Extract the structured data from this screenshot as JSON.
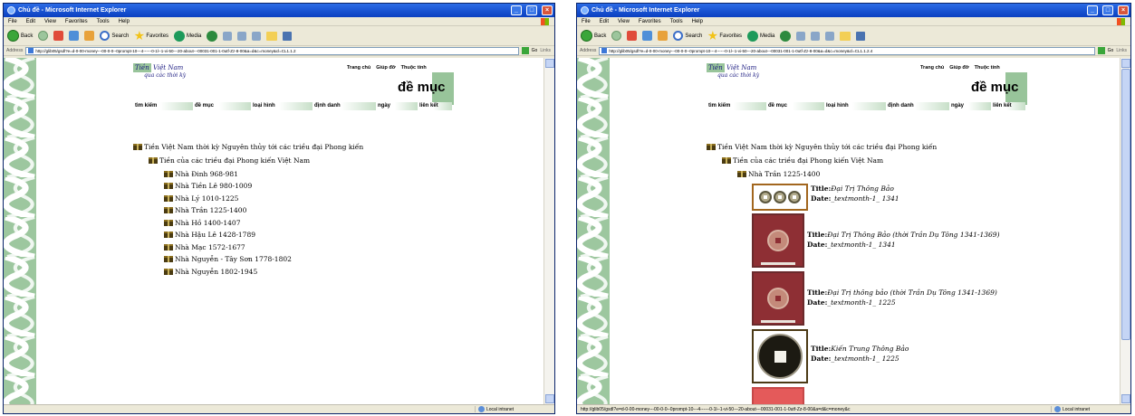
{
  "left": {
    "window_title": "Chủ đề - Microsoft Internet Explorer",
    "menu": [
      "File",
      "Edit",
      "View",
      "Favorites",
      "Tools",
      "Help"
    ],
    "toolbar": {
      "back": "Back",
      "search": "Search",
      "favorites": "Favorites",
      "media": "Media"
    },
    "address": {
      "label": "Address",
      "url": "http://glib05/gsdl?e=d-0-00-money---00-0-0--0prompt-10---4------0-1l--1-vi-50---20-about---00031-001-1-0utf-Zz-8-00&a=d&c=money&cl=CL1.1.2",
      "go": "Go",
      "links": "Links"
    },
    "status": {
      "text": "",
      "zone": "Local intranet"
    },
    "page": {
      "logo": {
        "line1a": "Tiền",
        "line1b": "Việt Nam",
        "line2": "qua các thời kỳ"
      },
      "toplinks": [
        "Trang chủ",
        "Giúp đỡ",
        "Thuộc tính"
      ],
      "section_title": "đề mục",
      "nav": [
        "tìm kiếm",
        "đề mục",
        "loại hình",
        "định danh",
        "ngày",
        "liên kết"
      ],
      "tree": {
        "level1": "Tiền Việt Nam thời kỳ Nguyên thủy tới các triều đại Phong kiến",
        "level2": "Tiền của các triều đại Phong kiến Việt Nam",
        "items": [
          "Nhà Đinh 968-981",
          "Nhà Tiền Lê 980-1009",
          "Nhà Lý 1010-1225",
          "Nhà Trần 1225-1400",
          "Nhà Hồ 1400-1407",
          "Nhà Hậu Lê 1428-1789",
          "Nhà Mạc 1572-1677",
          "Nhà Nguyễn - Tây Sơn 1778-1802",
          "Nhà Nguyễn 1802-1945"
        ]
      }
    }
  },
  "right": {
    "window_title": "Chủ đề - Microsoft Internet Explorer",
    "menu": [
      "File",
      "Edit",
      "View",
      "Favorites",
      "Tools",
      "Help"
    ],
    "toolbar": {
      "back": "Back",
      "search": "Search",
      "favorites": "Favorites",
      "media": "Media"
    },
    "address": {
      "label": "Address",
      "url": "http://glib05/gsdl?e=d-0-00-money---00-0-0--0prompt-10---4------0-1l--1-vi-50---20-about---00031-001-1-0utf-Zz-8-00&a=d&c=money&cl=CL1.1.2.4",
      "go": "Go",
      "links": "Links"
    },
    "status": {
      "text": "http://glib05/gsdl?e=d-0-00-money---00-0-0--0prompt-10---4------0-1l--1-vi-50---20-about---00031-001-1-0utf-Zz-8-00&a=d&c=money&c",
      "zone": "Local intranet"
    },
    "page": {
      "logo": {
        "line1a": "Tiền",
        "line1b": "Việt Nam",
        "line2": "qua các thời kỳ"
      },
      "toplinks": [
        "Trang chủ",
        "Giúp đỡ",
        "Thuộc tính"
      ],
      "section_title": "đề mục",
      "nav": [
        "tìm kiếm",
        "đề mục",
        "loại hình",
        "định danh",
        "ngày",
        "liên kết"
      ],
      "tree": {
        "level1": "Tiền Việt Nam thời kỳ Nguyên thủy tới các triều đại Phong kiến",
        "level2": "Tiền của các triều đại Phong kiến Việt Nam",
        "level3": "Nhà Trần 1225-1400"
      },
      "title_label": "Title:",
      "date_label": "Date:",
      "results": [
        {
          "title": "Đại Trị Thông Bảo",
          "date": "_textmonth-1_ 1341"
        },
        {
          "title": "Đại Trị Thông Bảo (thời Trần Dụ Tông 1341-1369)",
          "date": "_textmonth-1_ 1341"
        },
        {
          "title": "Đại Trị thông bảo (thời Trần Dụ Tông 1341-1369)",
          "date": "_textmonth-1_ 1225"
        },
        {
          "title": "Kiến Trung Thông Bảo",
          "date": "_textmonth-1_ 1225"
        }
      ]
    }
  }
}
